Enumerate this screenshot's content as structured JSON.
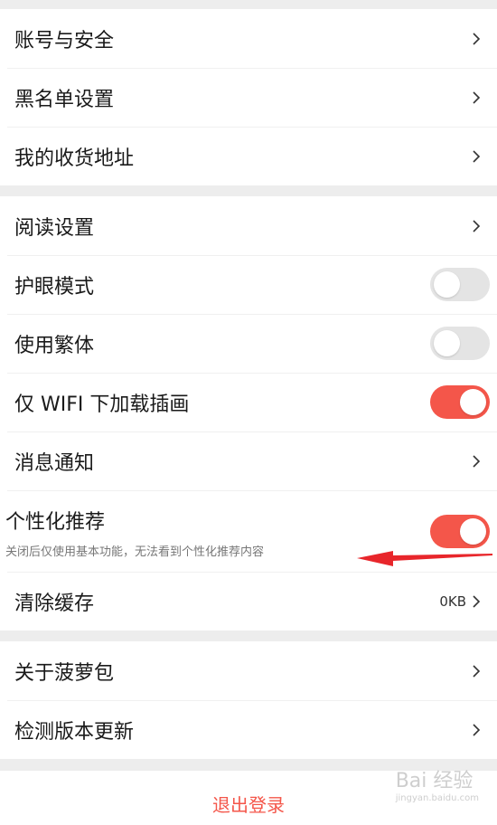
{
  "groups": [
    {
      "items": [
        {
          "label": "账号与安全",
          "type": "link"
        },
        {
          "label": "黑名单设置",
          "type": "link"
        },
        {
          "label": "我的收货地址",
          "type": "link"
        }
      ]
    },
    {
      "items": [
        {
          "label": "阅读设置",
          "type": "link"
        },
        {
          "label": "护眼模式",
          "type": "toggle",
          "on": false
        },
        {
          "label": "使用繁体",
          "type": "toggle",
          "on": false
        },
        {
          "label": "仅 WIFI 下加载插画",
          "type": "toggle",
          "on": true
        },
        {
          "label": "消息通知",
          "type": "link"
        },
        {
          "label": "个性化推荐",
          "sublabel": "关闭后仅使用基本功能，无法看到个性化推荐内容",
          "type": "toggle",
          "on": true
        },
        {
          "label": "清除缓存",
          "value": "0KB",
          "type": "link"
        }
      ]
    },
    {
      "items": [
        {
          "label": "关于菠萝包",
          "type": "link"
        },
        {
          "label": "检测版本更新",
          "type": "link"
        }
      ]
    }
  ],
  "logout_label": "退出登录",
  "watermark": {
    "text": "Bai 经验",
    "url": "jingyan.baidu.com"
  },
  "colors": {
    "accent": "#f4564a",
    "toggle_off": "#e4e4e4",
    "annotation_arrow": "#e8262b"
  },
  "icons": {
    "chevron": "chevron-right-icon"
  }
}
